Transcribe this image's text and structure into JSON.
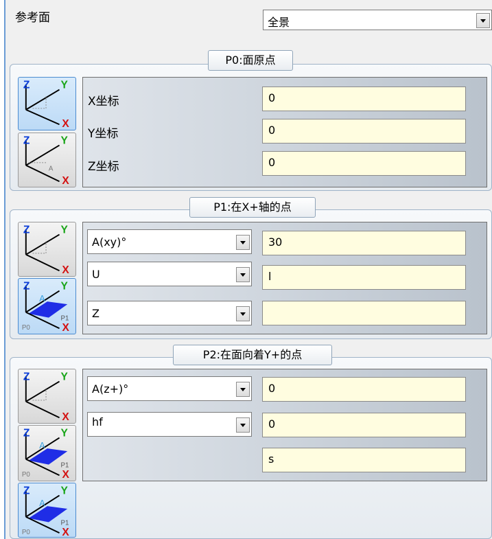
{
  "reference": {
    "label": "参考面",
    "view_value": "全景"
  },
  "p0": {
    "title": "P0:面原点",
    "rows": [
      {
        "label": "X坐标",
        "value": "0"
      },
      {
        "label": "Y坐标",
        "value": "0"
      },
      {
        "label": "Z坐标",
        "value": "0"
      }
    ]
  },
  "p1": {
    "title": "P1:在X+轴的点",
    "rows": [
      {
        "select": "A(xy)°",
        "value": "30"
      },
      {
        "select": "U",
        "value": "l"
      },
      {
        "select": "Z",
        "value": ""
      }
    ]
  },
  "p2": {
    "title": "P2:在面向着Y+的点",
    "rows": [
      {
        "select": "A(z+)°",
        "value": "0"
      },
      {
        "select": "hf",
        "value": "0"
      },
      {
        "value": "s"
      }
    ]
  },
  "axis_labels": {
    "z": "Z",
    "y": "Y",
    "x": "X",
    "a": "A",
    "p0": "P0",
    "p1": "P1"
  },
  "colors": {
    "z_axis": "#0a3dd8",
    "y_axis": "#1aa51a",
    "x_axis": "#d31212",
    "plane": "#1f2de6",
    "field_bg": "#fffde0",
    "active_button": "#bcdaf6"
  }
}
